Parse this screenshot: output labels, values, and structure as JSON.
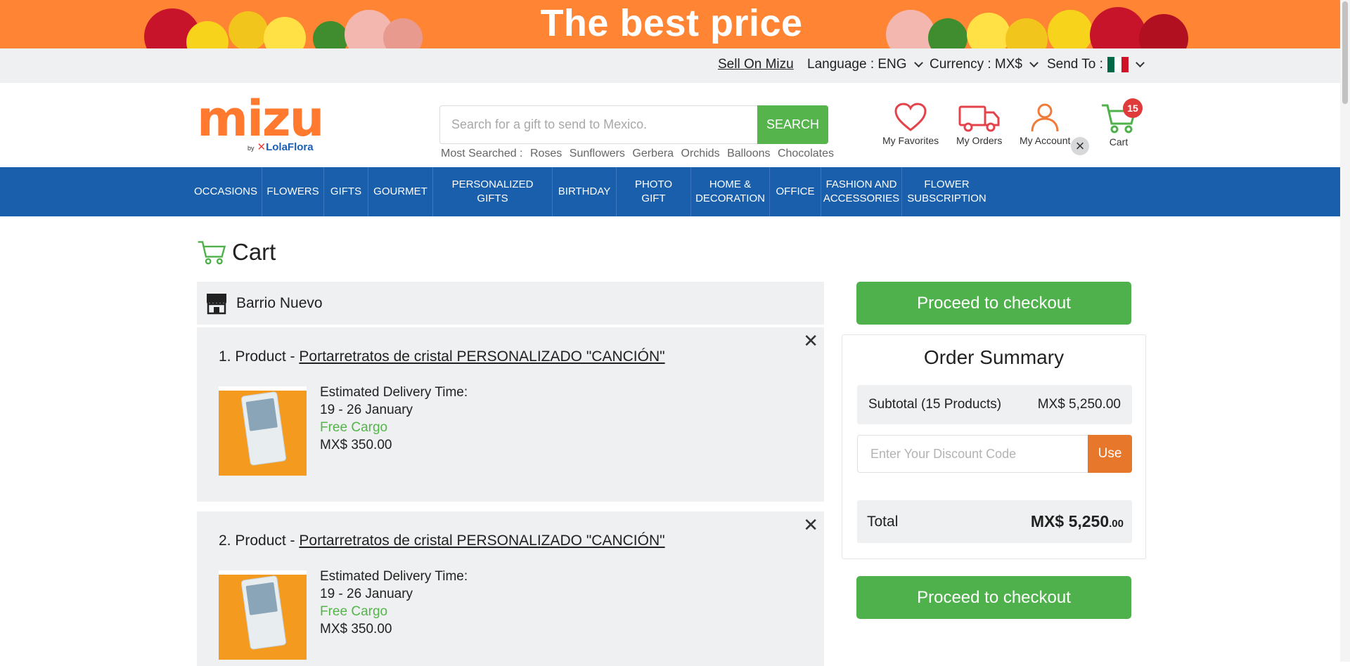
{
  "promo": {
    "text": "The best price"
  },
  "utility": {
    "sell": "Sell On Mizu",
    "language": "Language : ENG",
    "currency": "Currency : MX$",
    "send_to": "Send To :"
  },
  "logo": {
    "name": "mizu",
    "by": "by",
    "partner": "LolaFlora"
  },
  "search": {
    "placeholder": "Search for a gift to send to Mexico.",
    "button": "SEARCH",
    "most_label": "Most Searched :",
    "most_terms": [
      "Roses",
      "Sunflowers",
      "Gerbera",
      "Orchids",
      "Balloons",
      "Chocolates"
    ]
  },
  "header_icons": {
    "favorites": "My Favorites",
    "orders": "My Orders",
    "account": "My Account",
    "cart": "Cart",
    "cart_count": "15"
  },
  "nav": [
    "OCCASIONS",
    "FLOWERS",
    "GIFTS",
    "GOURMET",
    "PERSONALIZED GIFTS",
    "BIRTHDAY",
    "PHOTO GIFT",
    "HOME & DECORATION",
    "OFFICE",
    "FASHION AND ACCESSORIES",
    "FLOWER SUBSCRIPTION"
  ],
  "page": {
    "title": "Cart"
  },
  "store": {
    "name": "Barrio Nuevo"
  },
  "products": [
    {
      "prefix": "1. Product - ",
      "name": "Portarretratos de cristal PERSONALIZADO \"CANCIÓN\"",
      "delivery_label": "Estimated Delivery Time:",
      "delivery_dates": "19 - 26 January",
      "shipping": "Free Cargo",
      "price": "MX$ 350.00"
    },
    {
      "prefix": "2. Product - ",
      "name": "Portarretratos de cristal PERSONALIZADO \"CANCIÓN\"",
      "delivery_label": "Estimated Delivery Time:",
      "delivery_dates": "19 - 26 January",
      "shipping": "Free Cargo",
      "price": "MX$ 350.00"
    }
  ],
  "summary": {
    "checkout_label": "Proceed to checkout",
    "title": "Order Summary",
    "subtotal_label": "Subtotal (15 Products)",
    "subtotal_value": "MX$ 5,250.00",
    "discount_placeholder": "Enter Your Discount Code",
    "discount_button": "Use",
    "total_label": "Total",
    "total_main": "MX$ 5,250",
    "total_cents": ".00"
  },
  "colors": {
    "brand_orange": "#ff7a2e",
    "nav_blue": "#1a5fab",
    "checkout_green": "#4fb14b",
    "badge_red": "#e03b3b"
  }
}
